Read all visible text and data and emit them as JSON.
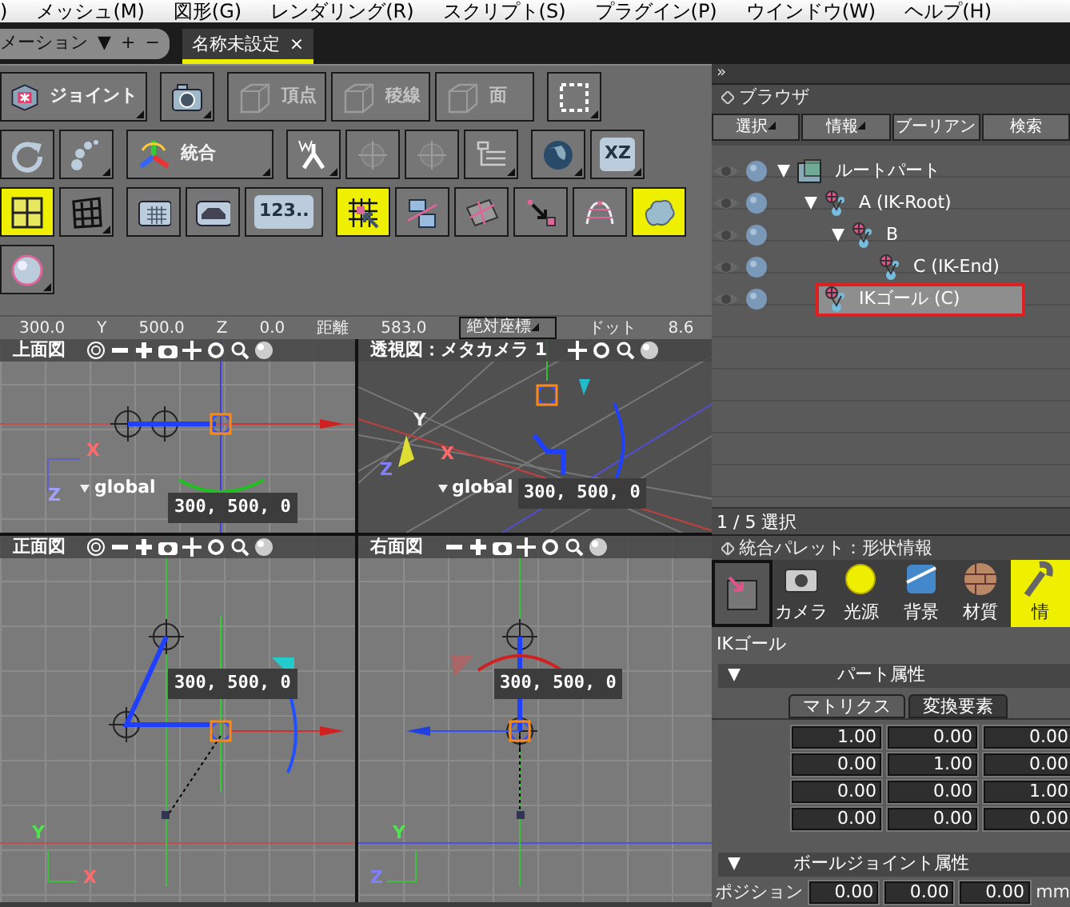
{
  "menu": [
    {
      "label": ")"
    },
    {
      "label": "メッシュ(M)"
    },
    {
      "label": "図形(G)"
    },
    {
      "label": "レンダリング(R)"
    },
    {
      "label": "スクリプト(S)"
    },
    {
      "label": "プラグイン(P)"
    },
    {
      "label": "ウインドウ(W)"
    },
    {
      "label": "ヘルプ(H)"
    }
  ],
  "doc_tabs": [
    {
      "kind": "panel",
      "label": "メーション",
      "controls": [
        "▼",
        "+",
        "−"
      ],
      "selected": false
    },
    {
      "kind": "document",
      "label": "名称未設定",
      "close": "×",
      "selected": true
    }
  ],
  "toolbar": [
    [
      {
        "label": "ジョイント",
        "disabled": false,
        "selected": false,
        "dropdown": true
      },
      {
        "disabled": false,
        "selected": false,
        "dropdown": true
      },
      {
        "label": "頂点",
        "disabled": true,
        "selected": false,
        "dropdown": false
      },
      {
        "label": "稜線",
        "disabled": true,
        "selected": false,
        "dropdown": false
      },
      {
        "label": "面",
        "disabled": true,
        "selected": false,
        "dropdown": false
      },
      {
        "disabled": false,
        "selected": false,
        "dropdown": true
      }
    ],
    [
      {
        "disabled": false,
        "selected": false,
        "dropdown": false
      },
      {
        "disabled": false,
        "selected": false,
        "dropdown": true
      },
      {
        "label": "統合",
        "disabled": false,
        "selected": false,
        "dropdown": true
      },
      {
        "disabled": false,
        "selected": false,
        "dropdown": true
      },
      {
        "disabled": true,
        "selected": false,
        "dropdown": false
      },
      {
        "disabled": true,
        "selected": false,
        "dropdown": false
      },
      {
        "disabled": false,
        "selected": false,
        "dropdown": true
      },
      {
        "disabled": false,
        "selected": false,
        "dropdown": true
      },
      {
        "label": "XZ",
        "disabled": false,
        "selected": false,
        "dropdown": true
      }
    ],
    [
      {
        "disabled": false,
        "selected": true,
        "dropdown": false
      },
      {
        "disabled": false,
        "selected": false,
        "dropdown": true
      },
      {
        "disabled": false,
        "selected": false,
        "dropdown": false
      },
      {
        "disabled": false,
        "selected": false,
        "dropdown": false
      },
      {
        "label": "123..",
        "disabled": false,
        "selected": false,
        "dropdown": false
      },
      {
        "disabled": false,
        "selected": true,
        "dropdown": false
      },
      {
        "disabled": false,
        "selected": false,
        "dropdown": false
      },
      {
        "disabled": false,
        "selected": false,
        "dropdown": false
      },
      {
        "disabled": false,
        "selected": false,
        "dropdown": false
      },
      {
        "disabled": false,
        "selected": false,
        "dropdown": false
      },
      {
        "disabled": false,
        "selected": true,
        "dropdown": false
      }
    ],
    [
      {
        "disabled": false,
        "selected": false,
        "dropdown": true
      }
    ]
  ],
  "coords": [
    {
      "kind": "value",
      "text": "300.0"
    },
    {
      "kind": "label",
      "text": "Y"
    },
    {
      "kind": "value",
      "text": "500.0"
    },
    {
      "kind": "label",
      "text": "Z"
    },
    {
      "kind": "value",
      "text": "0.0"
    },
    {
      "kind": "label",
      "text": "距離"
    },
    {
      "kind": "value",
      "text": "583.0"
    },
    {
      "kind": "dropdown",
      "text": "絶対座標"
    },
    {
      "kind": "label",
      "text": "ドット"
    },
    {
      "kind": "value",
      "text": "8.6"
    }
  ],
  "viewports": [
    {
      "kind": "top",
      "title": "上面図",
      "coord_label": "300, 500, 0",
      "space_label": "global",
      "axes": [
        "X",
        "Z"
      ]
    },
    {
      "kind": "perspective",
      "title": "透視図：メタカメラ 1",
      "coord_label": "300, 500, 0",
      "space_label": "global",
      "axes": [
        "Y",
        "Z",
        "X"
      ]
    },
    {
      "kind": "front",
      "title": "正面図",
      "coord_label": "300, 500, 0",
      "axes": [
        "Y",
        "X"
      ]
    },
    {
      "kind": "right",
      "title": "右面図",
      "coord_label": "300, 500, 0",
      "axes": [
        "Y",
        "Z"
      ]
    }
  ],
  "browser": {
    "collapse": "»",
    "title": "ブラウザ",
    "buttons": [
      {
        "label": "選択",
        "dropdown": true
      },
      {
        "label": "情報",
        "dropdown": true
      },
      {
        "label": "ブーリアン",
        "dropdown": false
      },
      {
        "label": "検索",
        "dropdown": false
      }
    ],
    "tree": [
      {
        "label": "ルートパート",
        "kind": "part",
        "expanded": true,
        "selected": false,
        "children": [
          {
            "label": "A (IK-Root)",
            "kind": "joint",
            "expanded": true,
            "selected": false,
            "children": [
              {
                "label": "B",
                "kind": "joint",
                "expanded": true,
                "selected": false,
                "children": [
                  {
                    "label": "C (IK-End)",
                    "kind": "joint",
                    "selected": false
                  }
                ]
              }
            ]
          },
          {
            "label": "IKゴール (C)",
            "kind": "joint",
            "selected": true
          }
        ]
      }
    ],
    "status": "1 / 5 選択"
  },
  "palette": {
    "title": "統合パレット：形状情報",
    "tabs": [
      {
        "selected": false
      },
      {
        "label": "カメラ",
        "selected": false
      },
      {
        "label": "光源",
        "selected": false
      },
      {
        "label": "背景",
        "selected": false
      },
      {
        "label": "材質",
        "selected": false
      },
      {
        "label": "情",
        "selected": true
      }
    ],
    "object_name": "IKゴール",
    "sections": [
      {
        "title": "パート属性",
        "tabs": [
          {
            "label": "マトリクス",
            "selected": true
          },
          {
            "label": "変換要素",
            "selected": false
          }
        ],
        "matrix": [
          [
            "1.00",
            "0.00",
            "0.00"
          ],
          [
            "0.00",
            "1.00",
            "0.00"
          ],
          [
            "0.00",
            "0.00",
            "1.00"
          ],
          [
            "0.00",
            "0.00",
            "0.00"
          ]
        ]
      },
      {
        "title": "ボールジョイント属性",
        "fields": [
          {
            "label": "ポジション",
            "values": [
              "0.00",
              "0.00",
              "0.00"
            ],
            "unit": "mm"
          }
        ]
      }
    ]
  }
}
